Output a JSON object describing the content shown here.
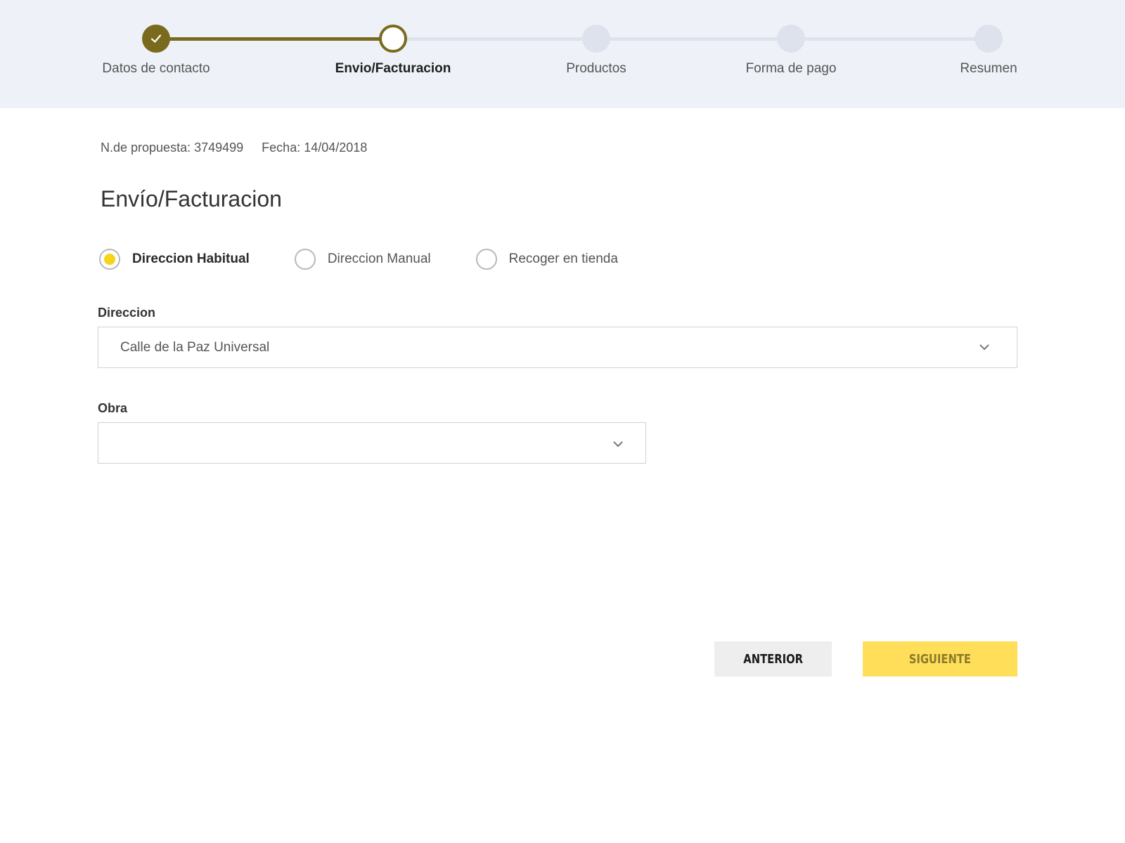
{
  "stepper": {
    "steps": [
      {
        "label": "Datos de contacto",
        "state": "done"
      },
      {
        "label": "Envio/Facturacion",
        "state": "current"
      },
      {
        "label": "Productos",
        "state": "pending"
      },
      {
        "label": "Forma de pago",
        "state": "pending"
      },
      {
        "label": "Resumen",
        "state": "pending"
      }
    ],
    "icons": {
      "done": "check-icon"
    }
  },
  "meta": {
    "proposal": "N.de propuesta: 3749499",
    "date": "Fecha: 14/04/2018"
  },
  "page": {
    "title": "Envío/Facturacion"
  },
  "delivery_options": {
    "selected": "Direccion Habitual",
    "options": [
      "Direccion Habitual",
      "Direccion Manual",
      "Recoger en tienda"
    ]
  },
  "form": {
    "direccion": {
      "label": "Direccion",
      "value": "Calle de la Paz Universal",
      "icon": "chevron-down-icon"
    },
    "obra": {
      "label": "Obra",
      "value": "",
      "icon": "chevron-down-icon"
    }
  },
  "actions": {
    "previous": "ANTERIOR",
    "next": "SIGUIENTE"
  },
  "colors": {
    "accent": "#7a6a1e",
    "radio_selected": "#f7d417",
    "primary_button": "#ffde59",
    "header_bg": "#eef1f8"
  }
}
